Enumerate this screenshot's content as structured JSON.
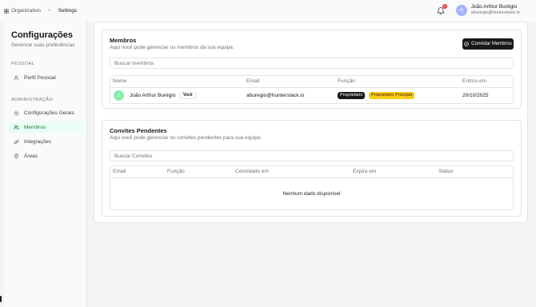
{
  "breadcrumb": {
    "org": "Organization",
    "separator": ">",
    "current": "Settings"
  },
  "header": {
    "notification_count": "1",
    "avatar_initial": "A",
    "user_name": "João Arthur Burégio",
    "user_email": "aburegio@hunterstack.io"
  },
  "sidebar": {
    "title": "Configurações",
    "subtitle": "Gerencie suas preferências",
    "sections": [
      {
        "label": "PESSOAL",
        "items": [
          {
            "label": "Perfil Pessoal",
            "icon": "user-icon"
          }
        ]
      },
      {
        "label": "ADMINISTRAÇÃO",
        "items": [
          {
            "label": "Configurações Gerais",
            "icon": "gear-icon"
          },
          {
            "label": "Membros",
            "icon": "users-icon",
            "active": true
          },
          {
            "label": "Integrações",
            "icon": "link-icon"
          },
          {
            "label": "Áreas",
            "icon": "map-pin-icon"
          }
        ]
      }
    ]
  },
  "members": {
    "title": "Membros",
    "subtitle": "Aqui você pode gerenciar os membros da sua equipe.",
    "invite_button": "Convidar Membros",
    "search_placeholder": "Buscar membros",
    "columns": [
      "Nome",
      "Email",
      "Função",
      "Entrou em"
    ],
    "rows": [
      {
        "initial": "J",
        "name": "João Arthur Burégio",
        "you_badge": "Você",
        "email": "aburegio@hunterstack.io",
        "roles": [
          "Proprietário",
          "Proprietário Principal"
        ],
        "joined": "20/10/2025"
      }
    ]
  },
  "invites": {
    "title": "Convites Pendentes",
    "subtitle": "Aqui você pode gerenciar os convites pendentes para sua equipe.",
    "search_placeholder": "Buscar Convites",
    "columns": [
      "Email",
      "Função",
      "Convidado em",
      "Expira em",
      "Status"
    ],
    "empty_text": "Nenhum dado disponível"
  },
  "colors": {
    "accent_active": "#15803d",
    "owner_badge": "#18181b",
    "principal_badge": "#facc15",
    "notification": "#ef4444"
  }
}
